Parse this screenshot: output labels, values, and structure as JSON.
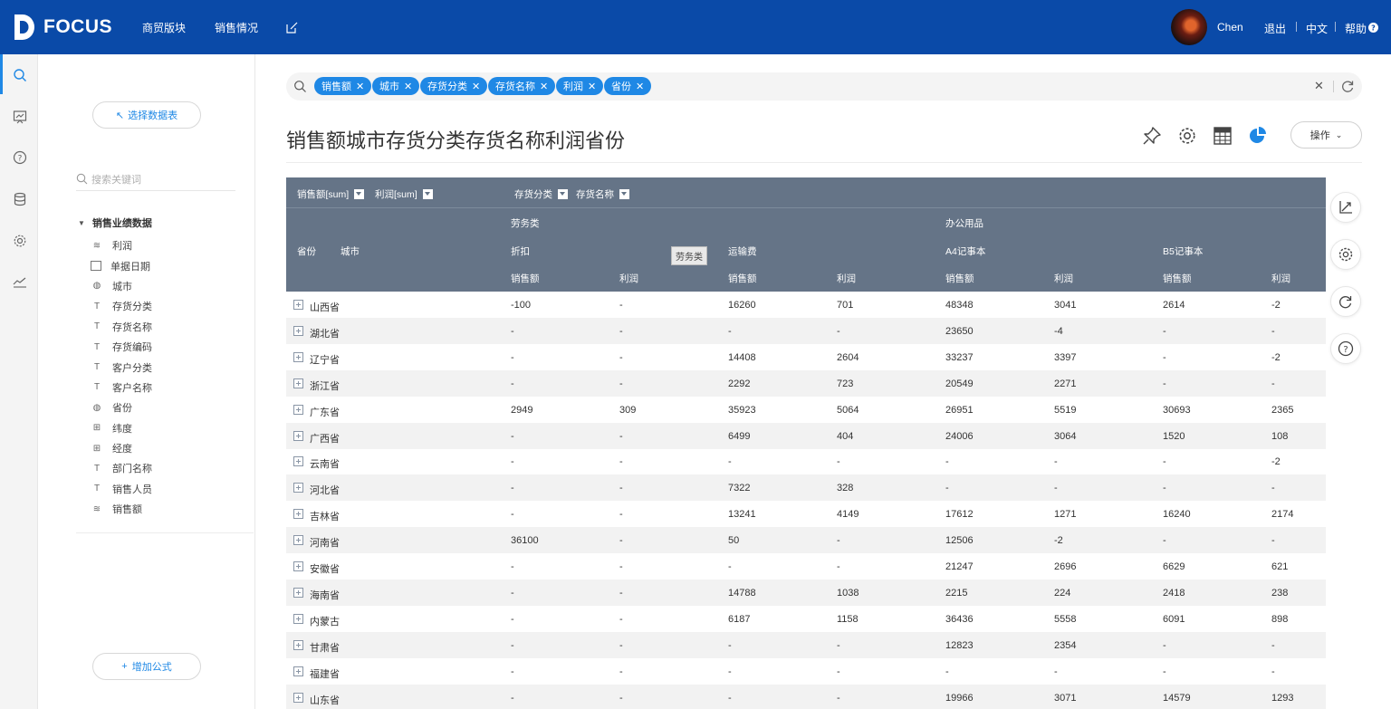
{
  "brand": {
    "name": "FOCUS"
  },
  "nav": [
    {
      "label": "商贸版块"
    },
    {
      "label": "销售情况"
    }
  ],
  "user": {
    "name": "Chen",
    "logout": "退出",
    "language": "中文",
    "help": "帮助"
  },
  "panel": {
    "select_table": "选择数据表",
    "search_placeholder": "搜索关键词",
    "tree_root": "销售业绩数据",
    "fields": [
      {
        "label": "利润",
        "icon": "measure-icon"
      },
      {
        "label": "单据日期",
        "icon": "calendar-icon"
      },
      {
        "label": "城市",
        "icon": "globe-icon"
      },
      {
        "label": "存货分类",
        "icon": "text-field-icon"
      },
      {
        "label": "存货名称",
        "icon": "text-field-icon"
      },
      {
        "label": "存货编码",
        "icon": "text-field-icon"
      },
      {
        "label": "客户分类",
        "icon": "text-field-icon"
      },
      {
        "label": "客户名称",
        "icon": "text-field-icon"
      },
      {
        "label": "省份",
        "icon": "globe-icon"
      },
      {
        "label": "纬度",
        "icon": "geo-coordinate-icon"
      },
      {
        "label": "经度",
        "icon": "geo-coordinate-icon"
      },
      {
        "label": "部门名称",
        "icon": "text-field-icon"
      },
      {
        "label": "销售人员",
        "icon": "text-field-icon"
      },
      {
        "label": "销售额",
        "icon": "measure-icon"
      }
    ],
    "add_formula": "增加公式"
  },
  "search": {
    "chips": [
      "销售额",
      "城市",
      "存货分类",
      "存货名称",
      "利润",
      "省份"
    ]
  },
  "title": "销售额城市存货分类存货名称利润省份",
  "operate_label": "操作",
  "table": {
    "measure_fields": [
      "销售额[sum]",
      "利润[sum]"
    ],
    "column_fields": [
      "存货分类",
      "存货名称"
    ],
    "row_headers": [
      "省份",
      "城市"
    ],
    "categories": [
      "劳务类",
      "办公用品"
    ],
    "items": [
      "折扣",
      "运输费",
      "A4记事本",
      "B5记事本"
    ],
    "measures": [
      "销售额",
      "利润",
      "销售额",
      "利润",
      "销售额",
      "利润",
      "销售额",
      "利润"
    ],
    "tooltip": "劳务类",
    "rows": [
      {
        "province": "山西省",
        "values": [
          "-100",
          "-",
          "16260",
          "701",
          "48348",
          "3041",
          "2614",
          "-2"
        ]
      },
      {
        "province": "湖北省",
        "values": [
          "-",
          "-",
          "-",
          "-",
          "23650",
          "-4",
          "-",
          "-"
        ]
      },
      {
        "province": "辽宁省",
        "values": [
          "-",
          "-",
          "14408",
          "2604",
          "33237",
          "3397",
          "-",
          "-2"
        ]
      },
      {
        "province": "浙江省",
        "values": [
          "-",
          "-",
          "2292",
          "723",
          "20549",
          "2271",
          "-",
          "-"
        ]
      },
      {
        "province": "广东省",
        "values": [
          "2949",
          "309",
          "35923",
          "5064",
          "26951",
          "5519",
          "30693",
          "2365"
        ]
      },
      {
        "province": "广西省",
        "values": [
          "-",
          "-",
          "6499",
          "404",
          "24006",
          "3064",
          "1520",
          "108"
        ]
      },
      {
        "province": "云南省",
        "values": [
          "-",
          "-",
          "-",
          "-",
          "-",
          "-",
          "-",
          "-2"
        ]
      },
      {
        "province": "河北省",
        "values": [
          "-",
          "-",
          "7322",
          "328",
          "-",
          "-",
          "-",
          "-"
        ]
      },
      {
        "province": "吉林省",
        "values": [
          "-",
          "-",
          "13241",
          "4149",
          "17612",
          "1271",
          "16240",
          "2174"
        ]
      },
      {
        "province": "河南省",
        "values": [
          "36100",
          "-",
          "50",
          "-",
          "12506",
          "-2",
          "-",
          "-"
        ]
      },
      {
        "province": "安徽省",
        "values": [
          "-",
          "-",
          "-",
          "-",
          "21247",
          "2696",
          "6629",
          "621"
        ]
      },
      {
        "province": "海南省",
        "values": [
          "-",
          "-",
          "14788",
          "1038",
          "2215",
          "224",
          "2418",
          "238"
        ]
      },
      {
        "province": "内蒙古",
        "values": [
          "-",
          "-",
          "6187",
          "1158",
          "36436",
          "5558",
          "6091",
          "898"
        ]
      },
      {
        "province": "甘肃省",
        "values": [
          "-",
          "-",
          "-",
          "-",
          "12823",
          "2354",
          "-",
          "-"
        ]
      },
      {
        "province": "福建省",
        "values": [
          "-",
          "-",
          "-",
          "-",
          "-",
          "-",
          "-",
          "-"
        ]
      },
      {
        "province": "山东省",
        "values": [
          "-",
          "-",
          "-",
          "-",
          "19966",
          "3071",
          "14579",
          "1293"
        ]
      }
    ]
  },
  "colors": {
    "topbar": "#0a4aa8",
    "accent": "#1f88e5",
    "table_header": "#657487"
  }
}
